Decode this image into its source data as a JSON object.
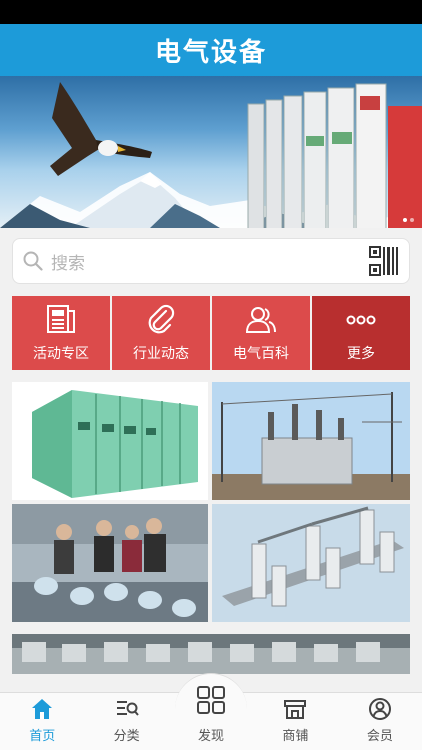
{
  "header": {
    "title": "电气设备"
  },
  "banner": {
    "dot_count": 2,
    "active_dot": 0
  },
  "search": {
    "placeholder": "搜索",
    "scan_icon": "qr-code-icon"
  },
  "quick_menu": [
    {
      "label": "活动专区",
      "icon": "newspaper-icon"
    },
    {
      "label": "行业动态",
      "icon": "paperclip-icon"
    },
    {
      "label": "电气百科",
      "icon": "people-icon"
    },
    {
      "label": "更多",
      "icon": "more-dots-icon"
    }
  ],
  "colors": {
    "header": "#1d9bd9",
    "quick_menu": "#dc4b4b",
    "quick_menu_more": "#b82f2f",
    "tab_active": "#1d9bd9"
  },
  "tabs": [
    {
      "label": "首页",
      "icon": "home-icon",
      "active": true
    },
    {
      "label": "分类",
      "icon": "category-list-icon",
      "active": false
    },
    {
      "label": "发现",
      "icon": "grid-icon",
      "active": false
    },
    {
      "label": "商铺",
      "icon": "shop-icon",
      "active": false
    },
    {
      "label": "会员",
      "icon": "user-icon",
      "active": false
    }
  ]
}
